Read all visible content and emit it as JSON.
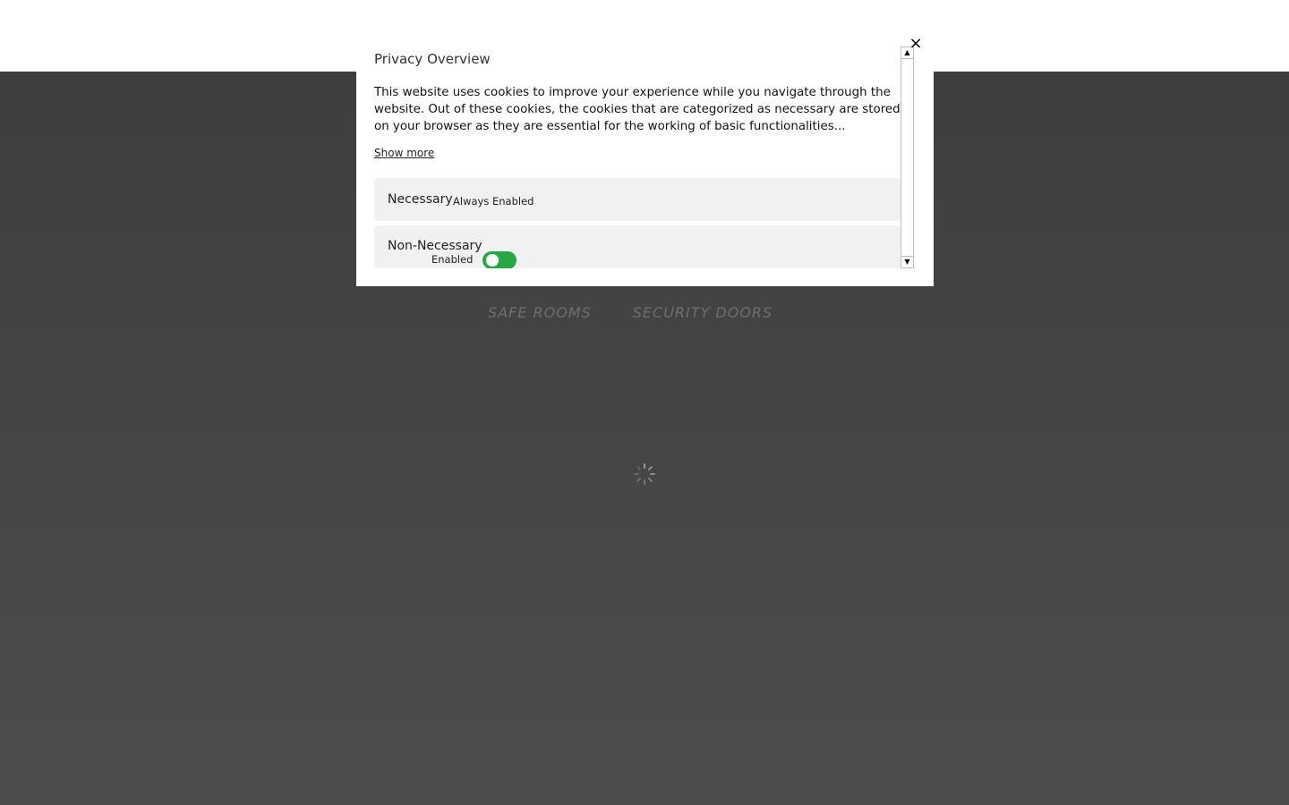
{
  "nav": {
    "items": [
      {
        "label": "SAFE ROOMS"
      },
      {
        "label": "SECURITY DOORS"
      }
    ]
  },
  "modal": {
    "title": "Privacy Overview",
    "body": "This website uses cookies to improve your experience while you navigate through the website. Out of these cookies, the cookies that are categorized as necessary are stored on your browser as they are essential for the working of basic functionalities...",
    "show_more": "Show more",
    "close_icon": "×",
    "categories": {
      "necessary": {
        "name": "Necessary",
        "badge": "Always Enabled"
      },
      "non_necessary": {
        "name": "Non-Necessary",
        "toggle_label": "Enabled",
        "toggle_on": true
      }
    }
  },
  "colors": {
    "toggle_on": "#28a745",
    "backdrop": "#454545",
    "category_bg": "#f1f1f1"
  },
  "icons": {
    "close": "close-icon",
    "spinner": "loading-spinner-icon",
    "scroll_up": "arrow-up-icon",
    "scroll_down": "arrow-down-icon"
  }
}
